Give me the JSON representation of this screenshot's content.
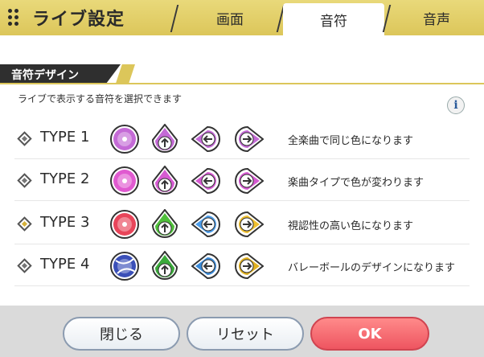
{
  "header": {
    "title": "ライブ設定",
    "tabs": [
      "画面",
      "音符",
      "音声"
    ],
    "active_tab": "音符"
  },
  "section": {
    "title": "音符デザイン",
    "description": "ライブで表示する音符を選択できます"
  },
  "info_button": "i",
  "types": [
    {
      "label": "TYPE 1",
      "description": "全楽曲で同じ色になります",
      "selected": false,
      "colors": [
        "#c46ad6",
        "#c46ad6",
        "#c46ad6",
        "#c46ad6"
      ]
    },
    {
      "label": "TYPE 2",
      "description": "楽曲タイプで色が変わります",
      "selected": false,
      "colors": [
        "#e05ad0",
        "#d65ad2",
        "#d65ad2",
        "#d65ad2"
      ]
    },
    {
      "label": "TYPE 3",
      "description": "視認性の高い色になります",
      "selected": true,
      "colors": [
        "#e8455a",
        "#4fbf3a",
        "#4a9be8",
        "#f0c030"
      ]
    },
    {
      "label": "TYPE 4",
      "description": "バレーボールのデザインになります",
      "selected": false,
      "colors": [
        "#3a4fb8",
        "#3aaa3a",
        "#3a8ad8",
        "#e0b020"
      ]
    }
  ],
  "buttons": {
    "close": "閉じる",
    "reset": "リセット",
    "ok": "OK"
  }
}
